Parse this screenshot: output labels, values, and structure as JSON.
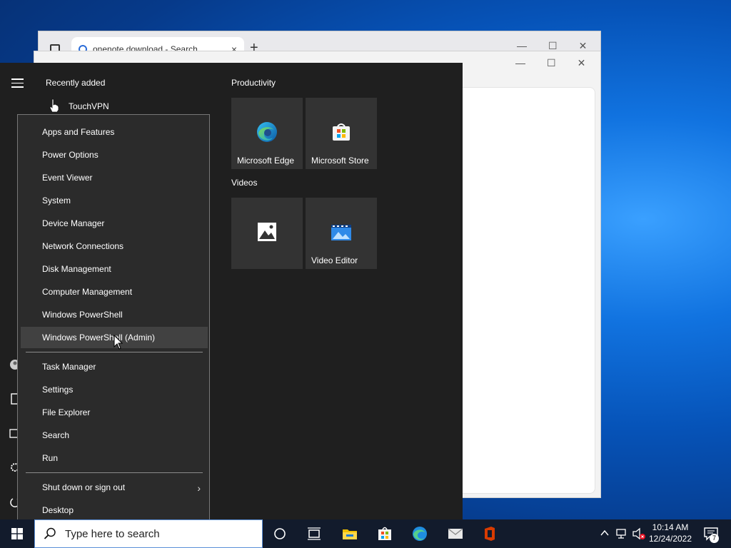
{
  "browser": {
    "tab_title": "onenote download - Search",
    "new_tab": "+",
    "close_tab": "×"
  },
  "start_menu": {
    "recently_added": "Recently added",
    "recent_apps": [
      {
        "label": "TouchVPN",
        "icon": "hand-pointer-icon"
      }
    ],
    "groups": [
      {
        "label": "Productivity",
        "tiles": [
          {
            "label": "Microsoft Edge",
            "icon": "edge-icon"
          },
          {
            "label": "Microsoft Store",
            "icon": "store-icon"
          }
        ]
      },
      {
        "label": "Videos",
        "tiles": [
          {
            "label": "",
            "icon": "photos-icon"
          },
          {
            "label": "Video Editor",
            "icon": "video-editor-icon"
          }
        ]
      }
    ]
  },
  "context_menu": {
    "items": [
      "Apps and Features",
      "Power Options",
      "Event Viewer",
      "System",
      "Device Manager",
      "Network Connections",
      "Disk Management",
      "Computer Management",
      "Windows PowerShell",
      "Windows PowerShell (Admin)",
      "Task Manager",
      "Settings",
      "File Explorer",
      "Search",
      "Run",
      "Shut down or sign out",
      "Desktop"
    ],
    "hovered": "Windows PowerShell (Admin)"
  },
  "taskbar": {
    "search_placeholder": "Type here to search",
    "time": "10:14 AM",
    "date": "12/24/2022",
    "notification_count": "7"
  },
  "colors": {
    "start_bg": "#1f1f1f",
    "menu_bg": "#2b2b2b",
    "tile_bg": "#333333",
    "taskbar_bg": "#121b2c",
    "accent": "#0078d7"
  }
}
